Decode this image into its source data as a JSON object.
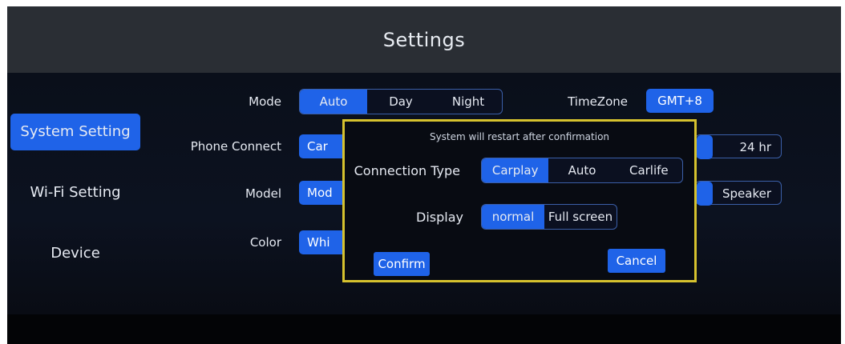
{
  "header": {
    "title": "Settings"
  },
  "sidebar": {
    "items": [
      {
        "label": "System Setting",
        "active": true
      },
      {
        "label": "Wi-Fi Setting",
        "active": false
      },
      {
        "label": "Device",
        "active": false
      }
    ]
  },
  "settings": {
    "mode": {
      "label": "Mode",
      "options": [
        "Auto",
        "Day",
        "Night"
      ],
      "selected": "Auto"
    },
    "timezone": {
      "label": "TimeZone",
      "value": "GMT+8"
    },
    "phone_connect": {
      "label": "Phone Connect",
      "value_partial": "Car"
    },
    "time_format": {
      "value": "24 hr"
    },
    "model": {
      "label": "Model",
      "value_partial": "Mod"
    },
    "audio_output": {
      "value": "Speaker"
    },
    "color": {
      "label": "Color",
      "value_partial": "Whi"
    }
  },
  "dialog": {
    "message": "System will restart after confirmation",
    "connection_type": {
      "label": "Connection Type",
      "options": [
        "Carplay",
        "Auto",
        "Carlife"
      ],
      "selected": "Carplay"
    },
    "display": {
      "label": "Display",
      "options": [
        "normal",
        "Full screen"
      ],
      "selected": "normal"
    },
    "confirm_label": "Confirm",
    "cancel_label": "Cancel"
  },
  "colors": {
    "accent": "#1f63e8",
    "dialog_border": "#d6c22e",
    "background": "#05070b",
    "header_band": "#2a2e34"
  }
}
